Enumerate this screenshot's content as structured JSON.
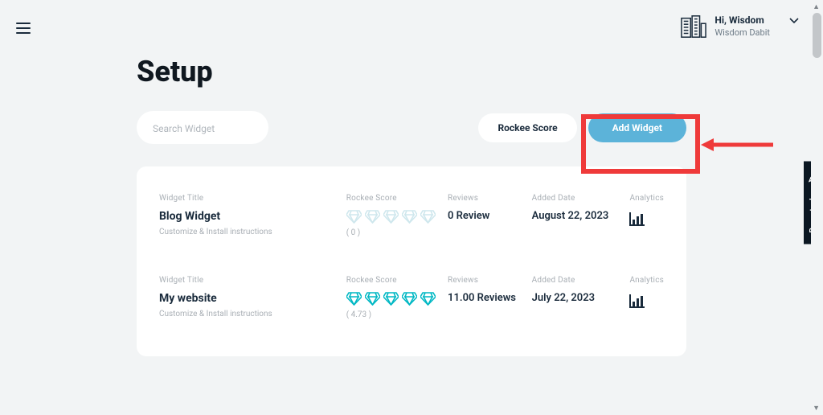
{
  "header": {
    "greeting": "Hi, Wisdom",
    "username": "Wisdom Dabit"
  },
  "page": {
    "title": "Setup"
  },
  "search": {
    "placeholder": "Search Widget"
  },
  "actions": {
    "rockee_score": "Rockee Score",
    "add_widget": "Add Widget"
  },
  "columns": {
    "widget_title": "Widget Title",
    "rockee_score": "Rockee Score",
    "reviews": "Reviews",
    "added_date": "Added Date",
    "analytics": "Analytics",
    "instructions": "Customize & Install instructions"
  },
  "widgets": [
    {
      "name": "Blog Widget",
      "score_display": "( 0 )",
      "score_value": 0,
      "reviews": "0 Review",
      "added_date": "August 22, 2023"
    },
    {
      "name": "My website",
      "score_display": "( 4.73 )",
      "score_value": 4.73,
      "reviews": "11.00 Reviews",
      "added_date": "July 22, 2023"
    }
  ],
  "bug_tab": "Report a bug",
  "colors": {
    "primary_button": "#5cb3d9",
    "highlight": "#ef3a3a",
    "diamond_active": "#00b8c4",
    "diamond_inactive": "#cfe7ed"
  }
}
